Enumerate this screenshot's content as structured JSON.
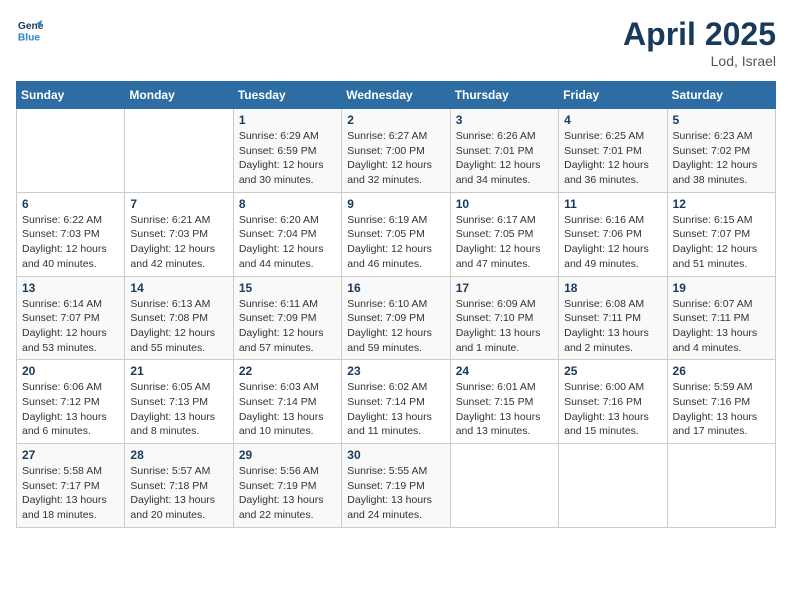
{
  "header": {
    "logo_line1": "General",
    "logo_line2": "Blue",
    "month": "April 2025",
    "location": "Lod, Israel"
  },
  "weekdays": [
    "Sunday",
    "Monday",
    "Tuesday",
    "Wednesday",
    "Thursday",
    "Friday",
    "Saturday"
  ],
  "weeks": [
    [
      {
        "day": "",
        "info": ""
      },
      {
        "day": "",
        "info": ""
      },
      {
        "day": "1",
        "info": "Sunrise: 6:29 AM\nSunset: 6:59 PM\nDaylight: 12 hours and 30 minutes."
      },
      {
        "day": "2",
        "info": "Sunrise: 6:27 AM\nSunset: 7:00 PM\nDaylight: 12 hours and 32 minutes."
      },
      {
        "day": "3",
        "info": "Sunrise: 6:26 AM\nSunset: 7:01 PM\nDaylight: 12 hours and 34 minutes."
      },
      {
        "day": "4",
        "info": "Sunrise: 6:25 AM\nSunset: 7:01 PM\nDaylight: 12 hours and 36 minutes."
      },
      {
        "day": "5",
        "info": "Sunrise: 6:23 AM\nSunset: 7:02 PM\nDaylight: 12 hours and 38 minutes."
      }
    ],
    [
      {
        "day": "6",
        "info": "Sunrise: 6:22 AM\nSunset: 7:03 PM\nDaylight: 12 hours and 40 minutes."
      },
      {
        "day": "7",
        "info": "Sunrise: 6:21 AM\nSunset: 7:03 PM\nDaylight: 12 hours and 42 minutes."
      },
      {
        "day": "8",
        "info": "Sunrise: 6:20 AM\nSunset: 7:04 PM\nDaylight: 12 hours and 44 minutes."
      },
      {
        "day": "9",
        "info": "Sunrise: 6:19 AM\nSunset: 7:05 PM\nDaylight: 12 hours and 46 minutes."
      },
      {
        "day": "10",
        "info": "Sunrise: 6:17 AM\nSunset: 7:05 PM\nDaylight: 12 hours and 47 minutes."
      },
      {
        "day": "11",
        "info": "Sunrise: 6:16 AM\nSunset: 7:06 PM\nDaylight: 12 hours and 49 minutes."
      },
      {
        "day": "12",
        "info": "Sunrise: 6:15 AM\nSunset: 7:07 PM\nDaylight: 12 hours and 51 minutes."
      }
    ],
    [
      {
        "day": "13",
        "info": "Sunrise: 6:14 AM\nSunset: 7:07 PM\nDaylight: 12 hours and 53 minutes."
      },
      {
        "day": "14",
        "info": "Sunrise: 6:13 AM\nSunset: 7:08 PM\nDaylight: 12 hours and 55 minutes."
      },
      {
        "day": "15",
        "info": "Sunrise: 6:11 AM\nSunset: 7:09 PM\nDaylight: 12 hours and 57 minutes."
      },
      {
        "day": "16",
        "info": "Sunrise: 6:10 AM\nSunset: 7:09 PM\nDaylight: 12 hours and 59 minutes."
      },
      {
        "day": "17",
        "info": "Sunrise: 6:09 AM\nSunset: 7:10 PM\nDaylight: 13 hours and 1 minute."
      },
      {
        "day": "18",
        "info": "Sunrise: 6:08 AM\nSunset: 7:11 PM\nDaylight: 13 hours and 2 minutes."
      },
      {
        "day": "19",
        "info": "Sunrise: 6:07 AM\nSunset: 7:11 PM\nDaylight: 13 hours and 4 minutes."
      }
    ],
    [
      {
        "day": "20",
        "info": "Sunrise: 6:06 AM\nSunset: 7:12 PM\nDaylight: 13 hours and 6 minutes."
      },
      {
        "day": "21",
        "info": "Sunrise: 6:05 AM\nSunset: 7:13 PM\nDaylight: 13 hours and 8 minutes."
      },
      {
        "day": "22",
        "info": "Sunrise: 6:03 AM\nSunset: 7:14 PM\nDaylight: 13 hours and 10 minutes."
      },
      {
        "day": "23",
        "info": "Sunrise: 6:02 AM\nSunset: 7:14 PM\nDaylight: 13 hours and 11 minutes."
      },
      {
        "day": "24",
        "info": "Sunrise: 6:01 AM\nSunset: 7:15 PM\nDaylight: 13 hours and 13 minutes."
      },
      {
        "day": "25",
        "info": "Sunrise: 6:00 AM\nSunset: 7:16 PM\nDaylight: 13 hours and 15 minutes."
      },
      {
        "day": "26",
        "info": "Sunrise: 5:59 AM\nSunset: 7:16 PM\nDaylight: 13 hours and 17 minutes."
      }
    ],
    [
      {
        "day": "27",
        "info": "Sunrise: 5:58 AM\nSunset: 7:17 PM\nDaylight: 13 hours and 18 minutes."
      },
      {
        "day": "28",
        "info": "Sunrise: 5:57 AM\nSunset: 7:18 PM\nDaylight: 13 hours and 20 minutes."
      },
      {
        "day": "29",
        "info": "Sunrise: 5:56 AM\nSunset: 7:19 PM\nDaylight: 13 hours and 22 minutes."
      },
      {
        "day": "30",
        "info": "Sunrise: 5:55 AM\nSunset: 7:19 PM\nDaylight: 13 hours and 24 minutes."
      },
      {
        "day": "",
        "info": ""
      },
      {
        "day": "",
        "info": ""
      },
      {
        "day": "",
        "info": ""
      }
    ]
  ]
}
